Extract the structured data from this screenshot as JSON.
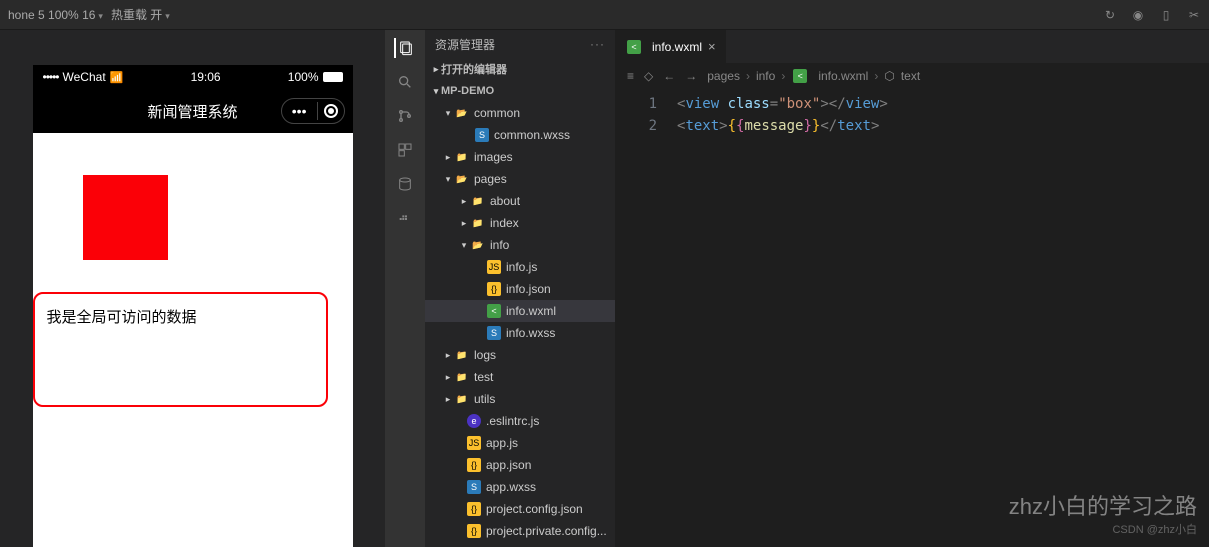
{
  "topbar": {
    "device": "hone 5 100% 16",
    "hot_reload": "热重载 开"
  },
  "phone": {
    "carrier": "WeChat",
    "signal_dots": "•••••",
    "time": "19:06",
    "battery": "100%",
    "app_title": "新闻管理系统",
    "text_content": "我是全局可访问的数据"
  },
  "explorer": {
    "title": "资源管理器",
    "sections": {
      "open_editors": "打开的编辑器",
      "project": "MP-DEMO"
    },
    "tree": {
      "common": "common",
      "common_wxss": "common.wxss",
      "images": "images",
      "pages": "pages",
      "about": "about",
      "index": "index",
      "info": "info",
      "info_js": "info.js",
      "info_json": "info.json",
      "info_wxml": "info.wxml",
      "info_wxss": "info.wxss",
      "logs": "logs",
      "test": "test",
      "utils": "utils",
      "eslintrc": ".eslintrc.js",
      "app_js": "app.js",
      "app_json": "app.json",
      "app_wxss": "app.wxss",
      "proj_config": "project.config.json",
      "proj_private": "project.private.config..."
    }
  },
  "tabs": {
    "file": "info.wxml"
  },
  "breadcrumb": {
    "p1": "pages",
    "p2": "info",
    "p3": "info.wxml",
    "p4": "text"
  },
  "editor": {
    "lines": [
      "1",
      "2"
    ],
    "l1": {
      "tag_open": "view",
      "attr_name": "class",
      "attr_val": "\"box\"",
      "tag_close": "view"
    },
    "l2": {
      "tag_open": "text",
      "var": "message",
      "tag_close": "text"
    }
  },
  "watermark": {
    "main": "zhz小白的学习之路",
    "sub": "CSDN @zhz小白"
  }
}
